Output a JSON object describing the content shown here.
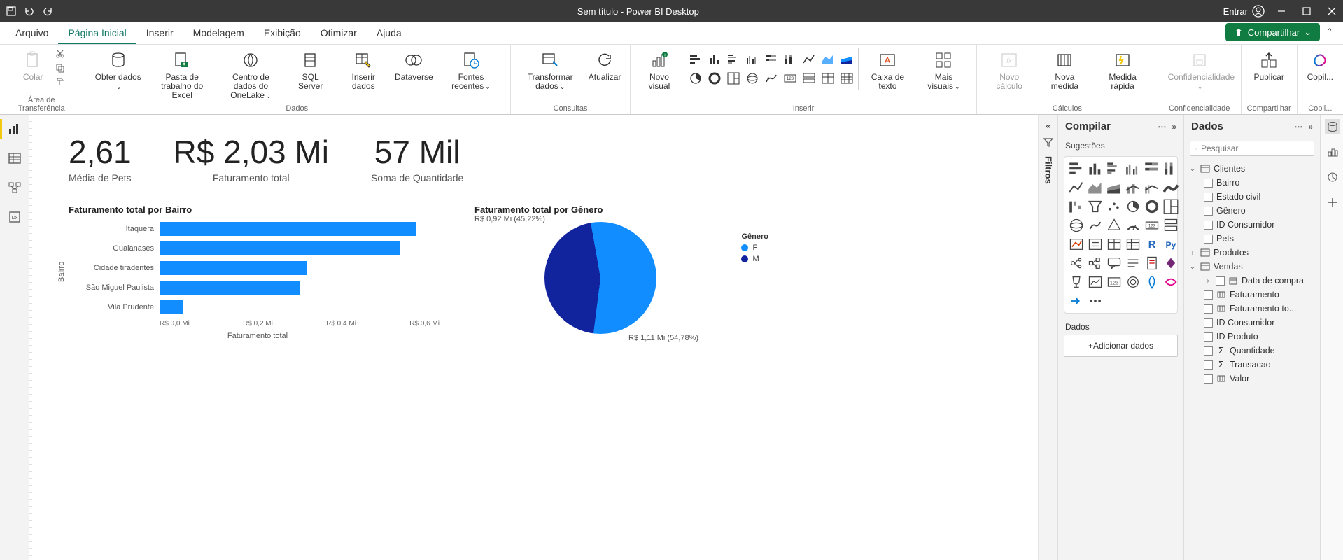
{
  "titlebar": {
    "title": "Sem título - Power BI Desktop",
    "signin": "Entrar"
  },
  "tabs": {
    "arquivo": "Arquivo",
    "pagina_inicial": "Página Inicial",
    "inserir": "Inserir",
    "modelagem": "Modelagem",
    "exibicao": "Exibição",
    "otimizar": "Otimizar",
    "ajuda": "Ajuda",
    "compartilhar": "Compartilhar"
  },
  "ribbon": {
    "groups": {
      "area_transferencia": "Área de Transferência",
      "dados": "Dados",
      "consultas": "Consultas",
      "inserir": "Inserir",
      "calculos": "Cálculos",
      "confidencialidade": "Confidencialidade",
      "compartilhar": "Compartilhar",
      "copilot": "Copil..."
    },
    "buttons": {
      "colar": "Colar",
      "obter_dados": "Obter dados",
      "pasta_excel": "Pasta de trabalho do Excel",
      "centro_onelake": "Centro de dados do OneLake",
      "sql_server": "SQL Server",
      "inserir_dados": "Inserir dados",
      "dataverse": "Dataverse",
      "fontes_recentes": "Fontes recentes",
      "transformar_dados": "Transformar dados",
      "atualizar": "Atualizar",
      "novo_visual": "Novo visual",
      "caixa_texto": "Caixa de texto",
      "mais_visuais": "Mais visuais",
      "novo_calculo": "Novo cálculo",
      "nova_medida": "Nova medida",
      "medida_rapida": "Medida rápida",
      "confidencialidade": "Confidencialidade",
      "publicar": "Publicar",
      "copilot": "Copil..."
    }
  },
  "kpis": {
    "k1": {
      "value": "2,61",
      "label": "Média de Pets"
    },
    "k2": {
      "value": "R$ 2,03 Mi",
      "label": "Faturamento total"
    },
    "k3": {
      "value": "57 Mil",
      "label": "Soma de Quantidade"
    }
  },
  "chart_data": [
    {
      "type": "bar",
      "title": "Faturamento total por Bairro",
      "xlabel": "Faturamento total",
      "ylabel": "Bairro",
      "categories": [
        "Itaquera",
        "Guaianases",
        "Cidade tiradentes",
        "São Miguel Paulista",
        "Vila Prudente"
      ],
      "values": [
        0.64,
        0.6,
        0.37,
        0.35,
        0.06
      ],
      "xlim": [
        0.0,
        0.7
      ],
      "xticks": [
        "R$ 0,0 Mi",
        "R$ 0,2 Mi",
        "R$ 0,4 Mi",
        "R$ 0,6 Mi"
      ]
    },
    {
      "type": "pie",
      "title": "Faturamento total por Gênero",
      "legend_title": "Gênero",
      "series": [
        {
          "name": "F",
          "label": "R$ 1,11 Mi (54,78%)",
          "value": 54.78,
          "color": "#118dff"
        },
        {
          "name": "M",
          "label": "R$ 0,92 Mi (45,22%)",
          "value": 45.22,
          "color": "#12239e"
        }
      ]
    }
  ],
  "filtros": {
    "label": "Filtros"
  },
  "compilar": {
    "title": "Compilar",
    "sugestoes": "Sugestões",
    "dados": "Dados",
    "add_data": "+Adicionar dados"
  },
  "dados_panel": {
    "title": "Dados",
    "search_placeholder": "Pesquisar",
    "tables": {
      "clientes": {
        "name": "Clientes",
        "fields": [
          "Bairro",
          "Estado civil",
          "Gênero",
          "ID Consumidor",
          "Pets"
        ]
      },
      "produtos": {
        "name": "Produtos"
      },
      "vendas": {
        "name": "Vendas",
        "fields": {
          "data_compra": "Data de compra",
          "faturamento": "Faturamento",
          "faturamento_to": "Faturamento to...",
          "id_consumidor": "ID Consumidor",
          "id_produto": "ID Produto",
          "quantidade": "Quantidade",
          "transacao": "Transacao",
          "valor": "Valor"
        }
      }
    }
  }
}
